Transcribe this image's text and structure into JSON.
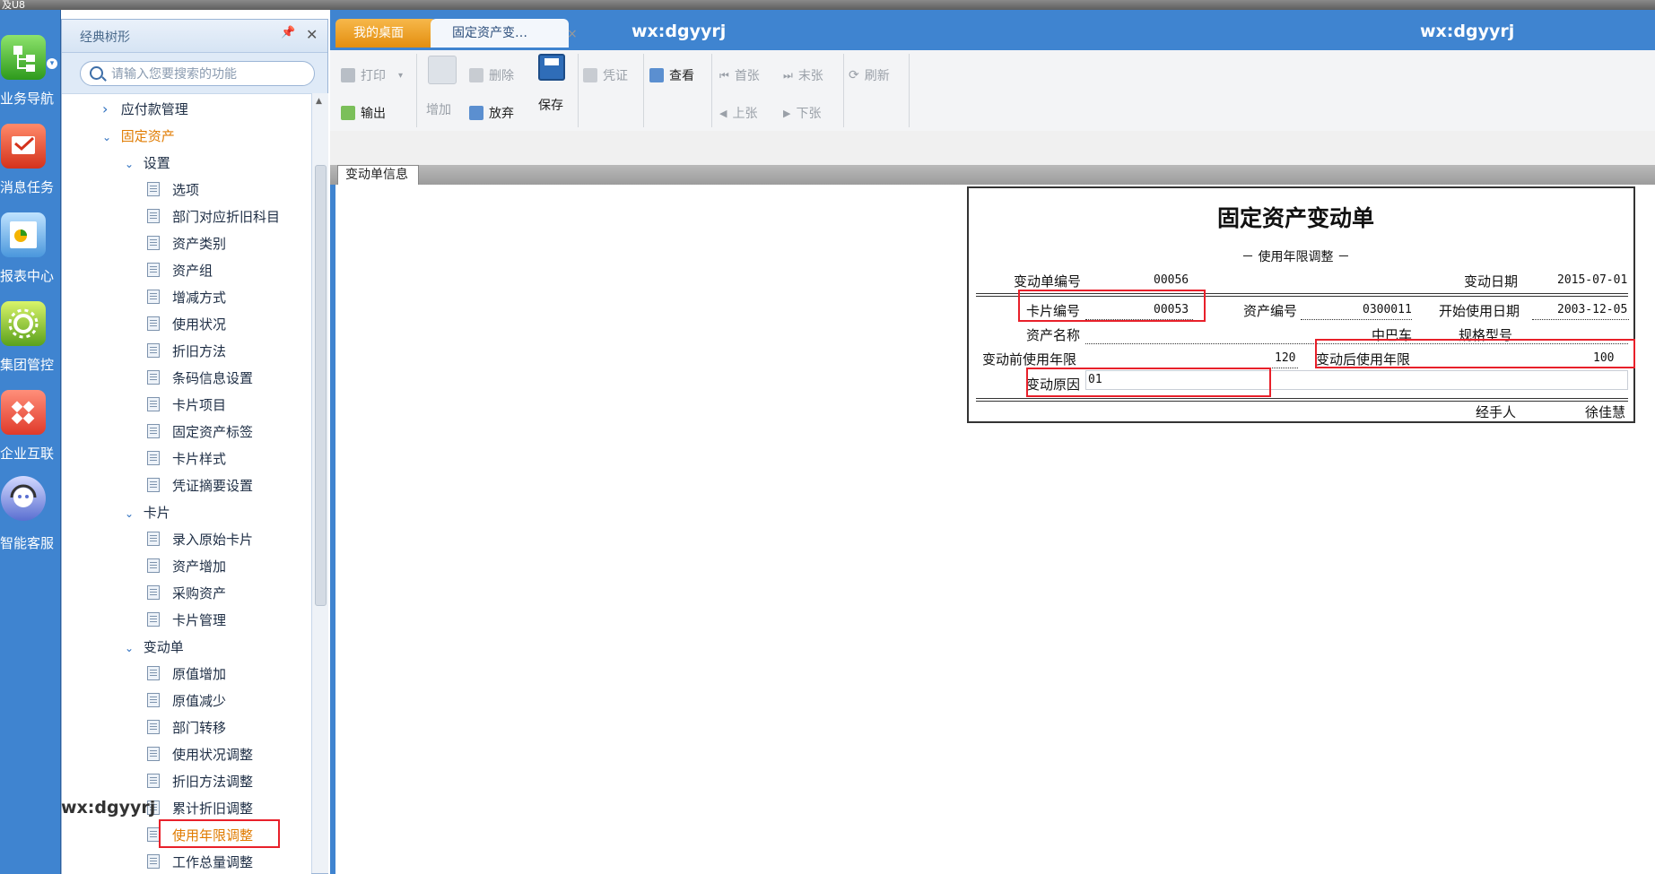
{
  "top_strip_text": "及U8",
  "rail": [
    {
      "label": "业务导航",
      "icon": "business-nav-icon"
    },
    {
      "label": "消息任务",
      "icon": "message-task-icon"
    },
    {
      "label": "报表中心",
      "icon": "report-center-icon"
    },
    {
      "label": "集团管控",
      "icon": "group-control-icon"
    },
    {
      "label": "企业互联",
      "icon": "enterprise-link-icon"
    },
    {
      "label": "智能客服",
      "icon": "smart-service-icon"
    }
  ],
  "tree_panel": {
    "title": "经典树形",
    "pin_glyph": "📌",
    "close_glyph": "✕",
    "search_placeholder": "请输入您要搜索的功能"
  },
  "tree": [
    {
      "label": "应付款管理",
      "level": 1,
      "type": "collapsed"
    },
    {
      "label": "固定资产",
      "level": 1,
      "type": "expanded"
    },
    {
      "label": "设置",
      "level": 2,
      "type": "expanded"
    },
    {
      "label": "选项",
      "level": 3,
      "type": "leaf"
    },
    {
      "label": "部门对应折旧科目",
      "level": 3,
      "type": "leaf"
    },
    {
      "label": "资产类别",
      "level": 3,
      "type": "leaf"
    },
    {
      "label": "资产组",
      "level": 3,
      "type": "leaf"
    },
    {
      "label": "增减方式",
      "level": 3,
      "type": "leaf"
    },
    {
      "label": "使用状况",
      "level": 3,
      "type": "leaf"
    },
    {
      "label": "折旧方法",
      "level": 3,
      "type": "leaf"
    },
    {
      "label": "条码信息设置",
      "level": 3,
      "type": "leaf"
    },
    {
      "label": "卡片项目",
      "level": 3,
      "type": "leaf"
    },
    {
      "label": "固定资产标签",
      "level": 3,
      "type": "leaf"
    },
    {
      "label": "卡片样式",
      "level": 3,
      "type": "leaf"
    },
    {
      "label": "凭证摘要设置",
      "level": 3,
      "type": "leaf"
    },
    {
      "label": "卡片",
      "level": 2,
      "type": "expanded"
    },
    {
      "label": "录入原始卡片",
      "level": 3,
      "type": "leaf"
    },
    {
      "label": "资产增加",
      "level": 3,
      "type": "leaf"
    },
    {
      "label": "采购资产",
      "level": 3,
      "type": "leaf"
    },
    {
      "label": "卡片管理",
      "level": 3,
      "type": "leaf"
    },
    {
      "label": "变动单",
      "level": 2,
      "type": "expanded"
    },
    {
      "label": "原值增加",
      "level": 3,
      "type": "leaf"
    },
    {
      "label": "原值减少",
      "level": 3,
      "type": "leaf"
    },
    {
      "label": "部门转移",
      "level": 3,
      "type": "leaf"
    },
    {
      "label": "使用状况调整",
      "level": 3,
      "type": "leaf"
    },
    {
      "label": "折旧方法调整",
      "level": 3,
      "type": "leaf"
    },
    {
      "label": "累计折旧调整",
      "level": 3,
      "type": "leaf"
    },
    {
      "label": "使用年限调整",
      "level": 3,
      "type": "leaf",
      "selected": true
    },
    {
      "label": "工作总量调整",
      "level": 3,
      "type": "leaf"
    }
  ],
  "tabs": {
    "desk": "我的桌面",
    "active": "固定资产变…",
    "close_glyph": "×"
  },
  "watermark": "wx:dgyyrj",
  "toolbar": {
    "print": "打印",
    "print_dropdown": "▾",
    "export": "输出",
    "add": "增加",
    "delete": "删除",
    "discard": "放弃",
    "save": "保存",
    "voucher": "凭证",
    "view": "查看",
    "first": "首张",
    "last": "末张",
    "prev": "上张",
    "next": "下张",
    "refresh": "刷新"
  },
  "sub_tab": "变动单信息",
  "form": {
    "title": "固定资产变动单",
    "subtitle": "－ 使用年限调整 －",
    "change_no_label": "变动单编号",
    "change_no": "00056",
    "change_date_label": "变动日期",
    "change_date": "2015-07-01",
    "card_no_label": "卡片编号",
    "card_no": "00053",
    "asset_no_label": "资产编号",
    "asset_no": "0300011",
    "start_date_label": "开始使用日期",
    "start_date": "2003-12-05",
    "asset_name_label": "资产名称",
    "asset_name": "中巴车",
    "spec_label": "规格型号",
    "spec": "",
    "before_years_label": "变动前使用年限",
    "before_years": "120",
    "after_years_label": "变动后使用年限",
    "after_years": "100",
    "reason_label": "变动原因",
    "reason": "01",
    "handler_label": "经手人",
    "handler": "徐佳慧"
  }
}
